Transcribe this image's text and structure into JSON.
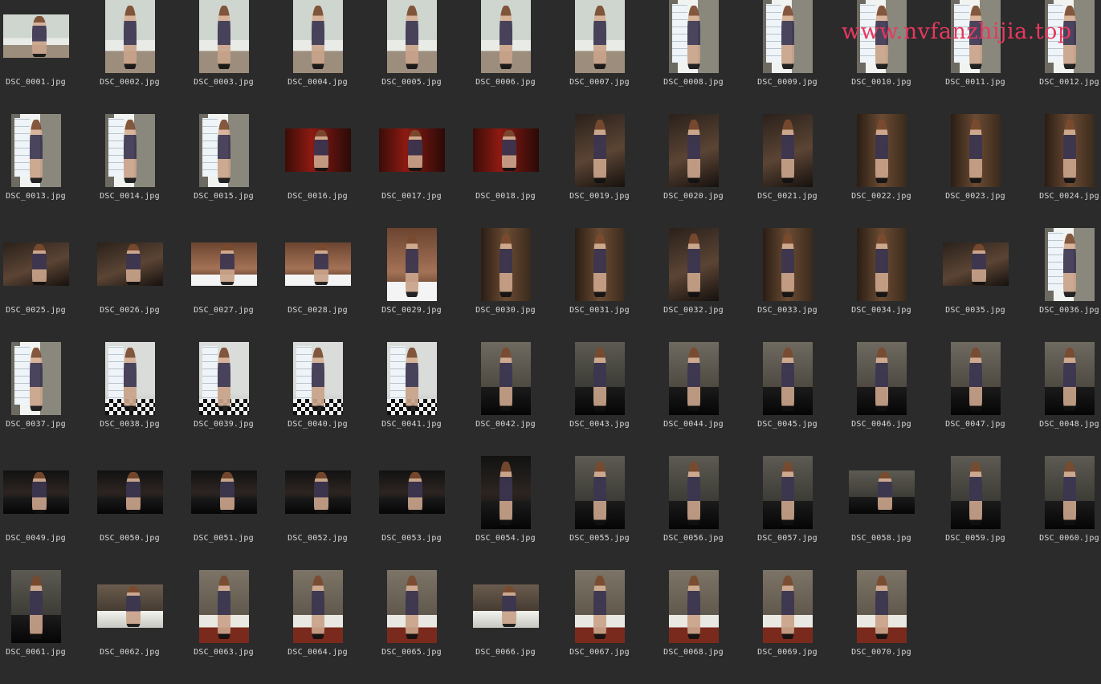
{
  "watermark": "www.nvfanzhijia.top",
  "files": [
    {
      "name": "DSC_0001.jpg",
      "orient": "land",
      "scene": "balcony"
    },
    {
      "name": "DSC_0002.jpg",
      "orient": "port",
      "scene": "balcony"
    },
    {
      "name": "DSC_0003.jpg",
      "orient": "port",
      "scene": "balcony"
    },
    {
      "name": "DSC_0004.jpg",
      "orient": "port",
      "scene": "balcony"
    },
    {
      "name": "DSC_0005.jpg",
      "orient": "port",
      "scene": "balcony"
    },
    {
      "name": "DSC_0006.jpg",
      "orient": "port",
      "scene": "balcony"
    },
    {
      "name": "DSC_0007.jpg",
      "orient": "port",
      "scene": "balcony"
    },
    {
      "name": "DSC_0008.jpg",
      "orient": "port",
      "scene": "window"
    },
    {
      "name": "DSC_0009.jpg",
      "orient": "port",
      "scene": "window"
    },
    {
      "name": "DSC_0010.jpg",
      "orient": "port",
      "scene": "window"
    },
    {
      "name": "DSC_0011.jpg",
      "orient": "port",
      "scene": "window"
    },
    {
      "name": "DSC_0012.jpg",
      "orient": "port",
      "scene": "window"
    },
    {
      "name": "DSC_0013.jpg",
      "orient": "port",
      "scene": "window"
    },
    {
      "name": "DSC_0014.jpg",
      "orient": "port",
      "scene": "window"
    },
    {
      "name": "DSC_0015.jpg",
      "orient": "port",
      "scene": "window"
    },
    {
      "name": "DSC_0016.jpg",
      "orient": "land",
      "scene": "redroom"
    },
    {
      "name": "DSC_0017.jpg",
      "orient": "land",
      "scene": "redroom"
    },
    {
      "name": "DSC_0018.jpg",
      "orient": "land",
      "scene": "redroom"
    },
    {
      "name": "DSC_0019.jpg",
      "orient": "port",
      "scene": "dark"
    },
    {
      "name": "DSC_0020.jpg",
      "orient": "port",
      "scene": "dark"
    },
    {
      "name": "DSC_0021.jpg",
      "orient": "port",
      "scene": "dark"
    },
    {
      "name": "DSC_0022.jpg",
      "orient": "port",
      "scene": "shelf"
    },
    {
      "name": "DSC_0023.jpg",
      "orient": "port",
      "scene": "shelf"
    },
    {
      "name": "DSC_0024.jpg",
      "orient": "port",
      "scene": "shelf"
    },
    {
      "name": "DSC_0025.jpg",
      "orient": "land",
      "scene": "dark"
    },
    {
      "name": "DSC_0026.jpg",
      "orient": "land",
      "scene": "dark"
    },
    {
      "name": "DSC_0027.jpg",
      "orient": "land",
      "scene": "sign"
    },
    {
      "name": "DSC_0028.jpg",
      "orient": "land",
      "scene": "sign"
    },
    {
      "name": "DSC_0029.jpg",
      "orient": "port",
      "scene": "sign"
    },
    {
      "name": "DSC_0030.jpg",
      "orient": "port",
      "scene": "shelf"
    },
    {
      "name": "DSC_0031.jpg",
      "orient": "port",
      "scene": "shelf"
    },
    {
      "name": "DSC_0032.jpg",
      "orient": "port",
      "scene": "dark"
    },
    {
      "name": "DSC_0033.jpg",
      "orient": "port",
      "scene": "shelf"
    },
    {
      "name": "DSC_0034.jpg",
      "orient": "port",
      "scene": "shelf"
    },
    {
      "name": "DSC_0035.jpg",
      "orient": "land",
      "scene": "dark"
    },
    {
      "name": "DSC_0036.jpg",
      "orient": "port",
      "scene": "window"
    },
    {
      "name": "DSC_0037.jpg",
      "orient": "port",
      "scene": "window"
    },
    {
      "name": "DSC_0038.jpg",
      "orient": "port",
      "scene": "checker"
    },
    {
      "name": "DSC_0039.jpg",
      "orient": "port",
      "scene": "checker"
    },
    {
      "name": "DSC_0040.jpg",
      "orient": "port",
      "scene": "checker"
    },
    {
      "name": "DSC_0041.jpg",
      "orient": "port",
      "scene": "checker"
    },
    {
      "name": "DSC_0042.jpg",
      "orient": "port",
      "scene": "blackcar"
    },
    {
      "name": "DSC_0043.jpg",
      "orient": "port",
      "scene": "garage"
    },
    {
      "name": "DSC_0044.jpg",
      "orient": "port",
      "scene": "blackcar"
    },
    {
      "name": "DSC_0045.jpg",
      "orient": "port",
      "scene": "blackcar"
    },
    {
      "name": "DSC_0046.jpg",
      "orient": "port",
      "scene": "blackcar"
    },
    {
      "name": "DSC_0047.jpg",
      "orient": "port",
      "scene": "blackcar"
    },
    {
      "name": "DSC_0048.jpg",
      "orient": "port",
      "scene": "blackcar"
    },
    {
      "name": "DSC_0049.jpg",
      "orient": "land",
      "scene": "carwindow"
    },
    {
      "name": "DSC_0050.jpg",
      "orient": "land",
      "scene": "carwindow"
    },
    {
      "name": "DSC_0051.jpg",
      "orient": "land",
      "scene": "carwindow"
    },
    {
      "name": "DSC_0052.jpg",
      "orient": "land",
      "scene": "carwindow"
    },
    {
      "name": "DSC_0053.jpg",
      "orient": "land",
      "scene": "carwindow"
    },
    {
      "name": "DSC_0054.jpg",
      "orient": "port",
      "scene": "carwindow"
    },
    {
      "name": "DSC_0055.jpg",
      "orient": "port",
      "scene": "garage"
    },
    {
      "name": "DSC_0056.jpg",
      "orient": "port",
      "scene": "garage"
    },
    {
      "name": "DSC_0057.jpg",
      "orient": "port",
      "scene": "garage"
    },
    {
      "name": "DSC_0058.jpg",
      "orient": "land",
      "scene": "garage"
    },
    {
      "name": "DSC_0059.jpg",
      "orient": "port",
      "scene": "garage"
    },
    {
      "name": "DSC_0060.jpg",
      "orient": "port",
      "scene": "garage"
    },
    {
      "name": "DSC_0061.jpg",
      "orient": "port",
      "scene": "garage"
    },
    {
      "name": "DSC_0062.jpg",
      "orient": "land",
      "scene": "whitecar"
    },
    {
      "name": "DSC_0063.jpg",
      "orient": "port",
      "scene": "redcar"
    },
    {
      "name": "DSC_0064.jpg",
      "orient": "port",
      "scene": "redcar"
    },
    {
      "name": "DSC_0065.jpg",
      "orient": "port",
      "scene": "redcar"
    },
    {
      "name": "DSC_0066.jpg",
      "orient": "land",
      "scene": "whitecar"
    },
    {
      "name": "DSC_0067.jpg",
      "orient": "port",
      "scene": "redcar"
    },
    {
      "name": "DSC_0068.jpg",
      "orient": "port",
      "scene": "redcar"
    },
    {
      "name": "DSC_0069.jpg",
      "orient": "port",
      "scene": "redcar"
    },
    {
      "name": "DSC_0070.jpg",
      "orient": "port",
      "scene": "redcar"
    }
  ]
}
